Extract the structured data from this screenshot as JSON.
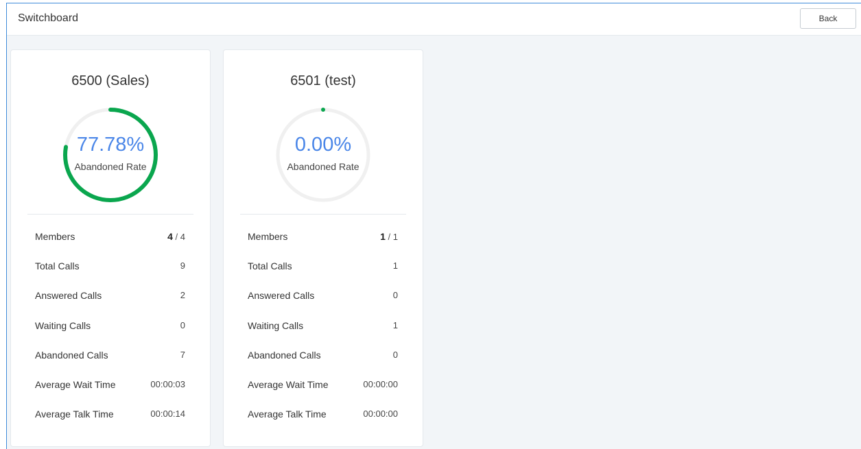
{
  "header": {
    "title": "Switchboard",
    "back_label": "Back"
  },
  "colors": {
    "accent_blue": "#4a86e8",
    "gauge_green": "#0aa64e",
    "gauge_track": "#f0f0f0"
  },
  "queues": [
    {
      "title": "6500 (Sales)",
      "abandoned_rate": "77.78%",
      "abandoned_rate_fraction": 0.7778,
      "abandoned_rate_label": "Abandoned Rate",
      "stats": {
        "members_label": "Members",
        "members_online": "4",
        "members_sep": " / ",
        "members_total": "4",
        "total_calls_label": "Total Calls",
        "total_calls": "9",
        "answered_calls_label": "Answered Calls",
        "answered_calls": "2",
        "waiting_calls_label": "Waiting Calls",
        "waiting_calls": "0",
        "abandoned_calls_label": "Abandoned Calls",
        "abandoned_calls": "7",
        "avg_wait_label": "Average Wait Time",
        "avg_wait": "00:00:03",
        "avg_talk_label": "Average Talk Time",
        "avg_talk": "00:00:14"
      }
    },
    {
      "title": "6501 (test)",
      "abandoned_rate": "0.00%",
      "abandoned_rate_fraction": 0.0,
      "abandoned_rate_label": "Abandoned Rate",
      "stats": {
        "members_label": "Members",
        "members_online": "1",
        "members_sep": " / ",
        "members_total": "1",
        "total_calls_label": "Total Calls",
        "total_calls": "1",
        "answered_calls_label": "Answered Calls",
        "answered_calls": "0",
        "waiting_calls_label": "Waiting Calls",
        "waiting_calls": "1",
        "abandoned_calls_label": "Abandoned Calls",
        "abandoned_calls": "0",
        "avg_wait_label": "Average Wait Time",
        "avg_wait": "00:00:00",
        "avg_talk_label": "Average Talk Time",
        "avg_talk": "00:00:00"
      }
    }
  ]
}
